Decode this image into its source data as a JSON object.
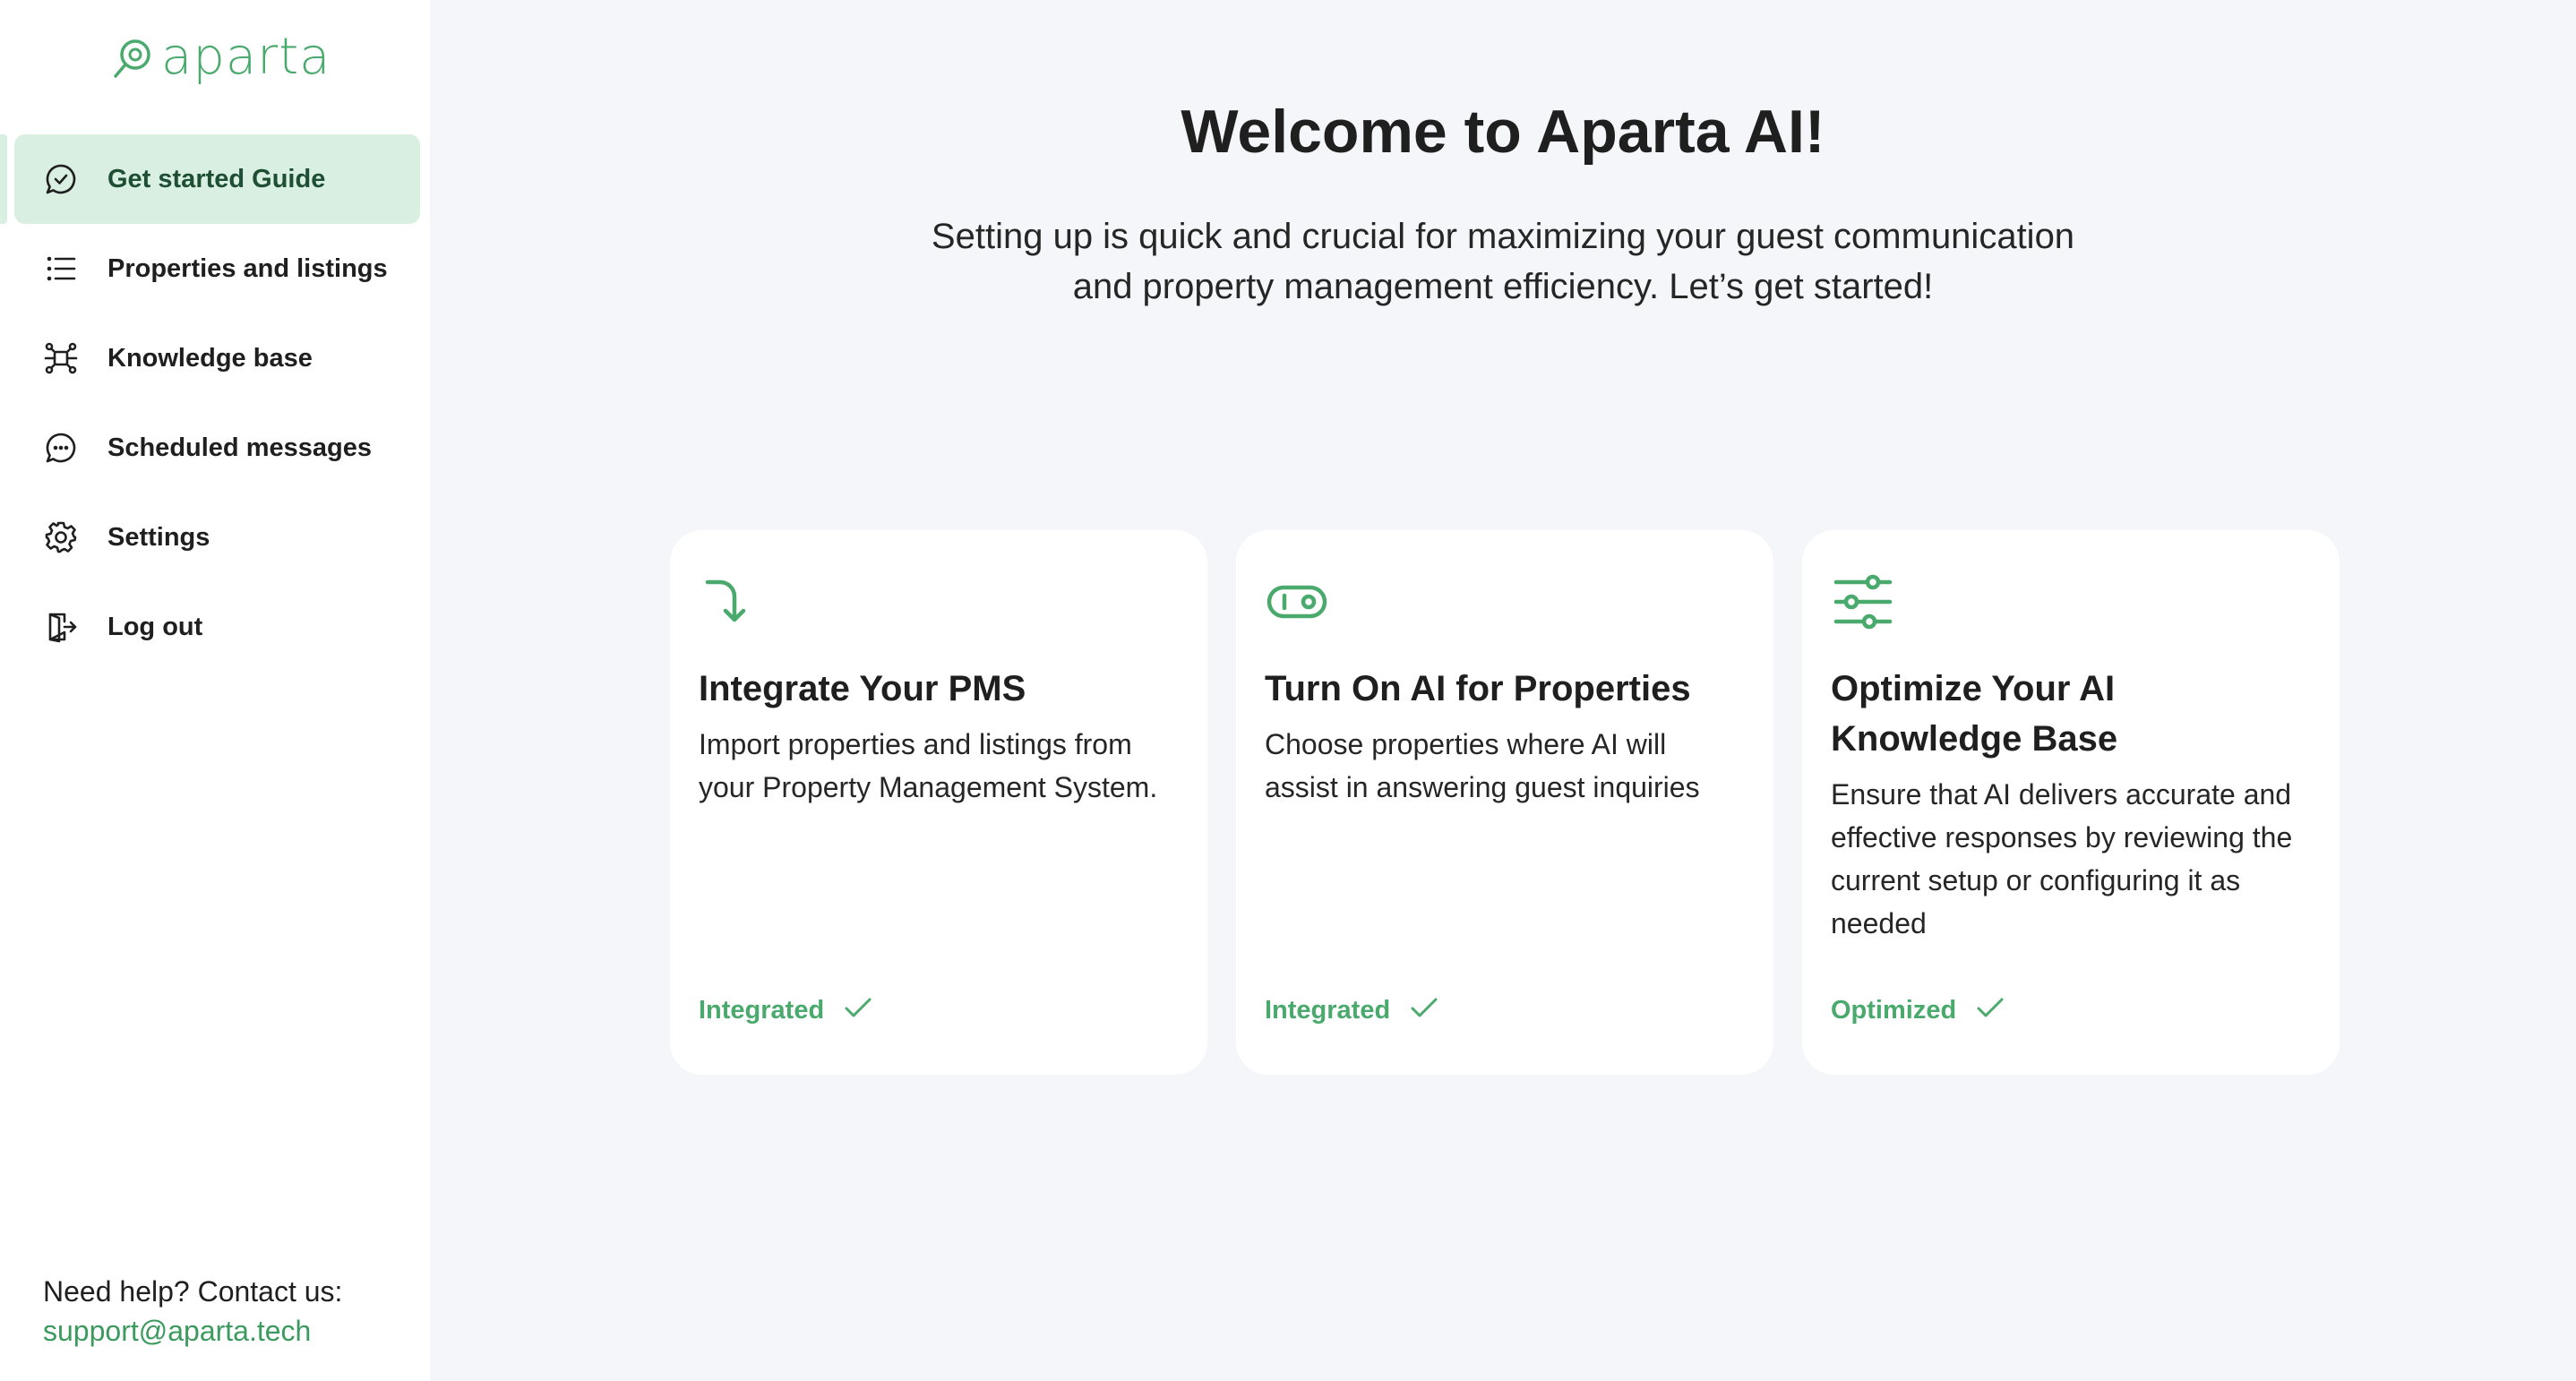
{
  "brand": {
    "name": "aparta",
    "color": "#4aa96c"
  },
  "sidebar": {
    "items": [
      {
        "label": "Get started Guide",
        "icon": "chat-check-icon",
        "active": true
      },
      {
        "label": "Properties and listings",
        "icon": "list-icon",
        "active": false
      },
      {
        "label": "Knowledge base",
        "icon": "network-icon",
        "active": false
      },
      {
        "label": "Scheduled messages",
        "icon": "chat-dots-icon",
        "active": false
      },
      {
        "label": "Settings",
        "icon": "gear-icon",
        "active": false
      },
      {
        "label": "Log out",
        "icon": "logout-icon",
        "active": false
      }
    ],
    "help": {
      "title": "Need help? Contact us:",
      "email": "support@aparta.tech"
    }
  },
  "main": {
    "title": "Welcome to Aparta AI!",
    "subtitle": "Setting up is quick and crucial for maximizing your guest communication and property management efficiency. Let’s get started!",
    "cards": [
      {
        "icon": "arrow-turn-down-icon",
        "title": "Integrate Your PMS",
        "description": "Import properties and listings from your Property Management System.",
        "status": "Integrated"
      },
      {
        "icon": "toggle-icon",
        "title": "Turn On AI for Properties",
        "description": "Choose properties where AI will assist in answering guest inquiries",
        "status": "Integrated"
      },
      {
        "icon": "sliders-icon",
        "title": "Optimize Your AI Knowledge Base",
        "description": "Ensure that AI delivers accurate and effective responses by reviewing the current setup or configuring it as needed",
        "status": "Optimized"
      }
    ]
  }
}
